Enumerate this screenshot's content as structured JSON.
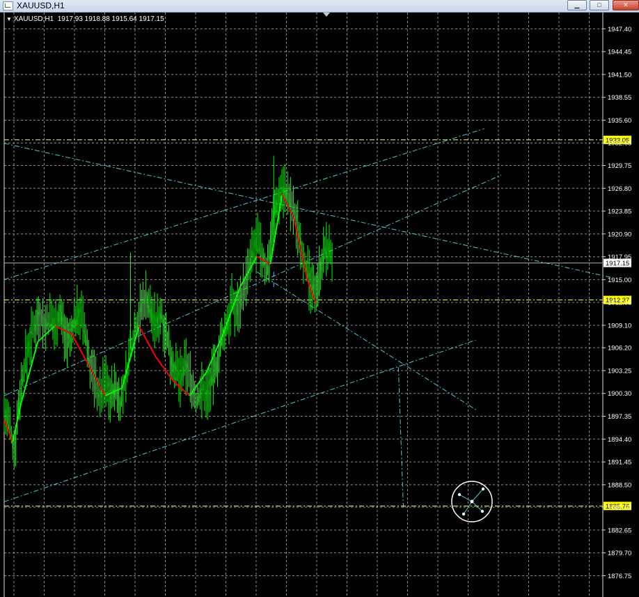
{
  "window": {
    "title": "XAUUSD,H1",
    "controls": {
      "minimize": "▁",
      "maximize": "□",
      "close": "✕"
    }
  },
  "chart_info": {
    "symbol": "XAUUSD,H1",
    "ohlc": "1917.93 1918.88 1915.64 1917.15"
  },
  "colors": {
    "background": "#000000",
    "grid": "#bfbfbf",
    "candles": "#00ff00",
    "moving_average": "#ff0000",
    "trendlines": "#4ec9d6",
    "hline": "#ffff66",
    "price_label_bg": "#ffff00",
    "current_price_bg": "#ffffff"
  },
  "icons": {
    "crosshair_tool": "fibonacci-anchor-icon",
    "collapse": "triangle-down-icon"
  },
  "chart_data": {
    "type": "candlestick",
    "price_axis": {
      "ticks": [
        "1947.40",
        "1944.45",
        "1941.50",
        "1938.55",
        "1935.60",
        "1932.65",
        "1929.75",
        "1926.80",
        "1923.85",
        "1920.90",
        "1917.95",
        "1915.00",
        "1912.05",
        "1909.10",
        "1906.20",
        "1903.25",
        "1900.30",
        "1897.35",
        "1894.40",
        "1891.45",
        "1888.50",
        "1885.60",
        "1882.65",
        "1879.70",
        "1876.75"
      ],
      "ylim": [
        1874.0,
        1949.5
      ]
    },
    "current_price": "1917.15",
    "horizontal_levels": [
      "1933.05",
      "1912.37",
      "1885.76"
    ],
    "close_path": [
      [
        0,
        1898
      ],
      [
        3,
        1896
      ],
      [
        6,
        1893
      ],
      [
        9,
        1900
      ],
      [
        12,
        1904
      ],
      [
        15,
        1907
      ],
      [
        18,
        1909
      ],
      [
        21,
        1911
      ],
      [
        24,
        1909
      ],
      [
        27,
        1910
      ],
      [
        30,
        1909
      ],
      [
        33,
        1911
      ],
      [
        36,
        1908
      ],
      [
        39,
        1907
      ],
      [
        42,
        1910
      ],
      [
        45,
        1911
      ],
      [
        48,
        1908
      ],
      [
        51,
        1904
      ],
      [
        54,
        1902
      ],
      [
        57,
        1900
      ],
      [
        60,
        1902
      ],
      [
        63,
        1900
      ],
      [
        66,
        1901
      ],
      [
        69,
        1899
      ],
      [
        72,
        1902
      ],
      [
        75,
        1906
      ],
      [
        78,
        1909
      ],
      [
        81,
        1911
      ],
      [
        84,
        1913
      ],
      [
        87,
        1911
      ],
      [
        90,
        1909
      ],
      [
        93,
        1911
      ],
      [
        96,
        1908
      ],
      [
        99,
        1905
      ],
      [
        102,
        1903
      ],
      [
        105,
        1902
      ],
      [
        108,
        1904
      ],
      [
        111,
        1902
      ],
      [
        114,
        1899
      ],
      [
        117,
        1901
      ],
      [
        120,
        1900
      ],
      [
        123,
        1902
      ],
      [
        126,
        1904
      ],
      [
        129,
        1907
      ],
      [
        132,
        1909
      ],
      [
        135,
        1912
      ],
      [
        138,
        1911
      ],
      [
        141,
        1913
      ],
      [
        144,
        1915
      ],
      [
        147,
        1918
      ],
      [
        150,
        1920
      ],
      [
        153,
        1918
      ],
      [
        156,
        1916
      ],
      [
        159,
        1922
      ],
      [
        162,
        1925
      ],
      [
        165,
        1927
      ],
      [
        168,
        1926
      ],
      [
        171,
        1924
      ],
      [
        174,
        1922
      ],
      [
        177,
        1919
      ],
      [
        180,
        1916
      ],
      [
        183,
        1913
      ],
      [
        186,
        1915
      ],
      [
        189,
        1918
      ],
      [
        192,
        1919
      ],
      [
        195,
        1918
      ]
    ],
    "ma_path": [
      [
        0,
        1897
      ],
      [
        5,
        1894
      ],
      [
        10,
        1899
      ],
      [
        20,
        1907
      ],
      [
        30,
        1909
      ],
      [
        40,
        1908
      ],
      [
        50,
        1904
      ],
      [
        60,
        1900
      ],
      [
        70,
        1901
      ],
      [
        80,
        1909
      ],
      [
        90,
        1905
      ],
      [
        100,
        1902
      ],
      [
        110,
        1900
      ],
      [
        120,
        1903
      ],
      [
        130,
        1908
      ],
      [
        140,
        1914
      ],
      [
        150,
        1918
      ],
      [
        158,
        1917
      ],
      [
        165,
        1926
      ],
      [
        172,
        1923
      ],
      [
        180,
        1915
      ],
      [
        185,
        1912
      ]
    ],
    "trendlines": [
      {
        "from": [
          0,
          1915.0
        ],
        "to": [
          285,
          1934.5
        ],
        "style": "dashdot"
      },
      {
        "from": [
          0,
          1932.6
        ],
        "to": [
          360,
          1915.3
        ],
        "style": "dashdot"
      },
      {
        "from": [
          0,
          1886.3
        ],
        "to": [
          280,
          1907.2
        ],
        "style": "dashdot"
      },
      {
        "from": [
          0,
          1900.0
        ],
        "to": [
          295,
          1928.5
        ],
        "style": "dashdot"
      },
      {
        "from": [
          150,
          1916.0
        ],
        "to": [
          280,
          1898.2
        ],
        "style": "dashdot"
      },
      {
        "from": [
          160,
          1916.0
        ],
        "to": [
          160,
          1914.0
        ],
        "style": "dashdot"
      },
      {
        "from": [
          234,
          1903.7
        ],
        "to": [
          237,
          1885.5
        ],
        "style": "dashdot"
      }
    ]
  }
}
